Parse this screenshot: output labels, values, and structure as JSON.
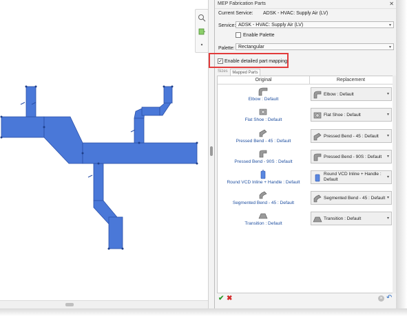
{
  "panel": {
    "title": "MEP Fabrication Parts",
    "close_glyph": "✕",
    "current_service_label": "Current Service:",
    "current_service_value": "ADSK - HVAC: Supply Air (LV)",
    "service_label": "Service:",
    "service_value": "ADSK - HVAC: Supply Air (LV)",
    "enable_palette_label": "Enable Palette",
    "palette_label": "Palette:",
    "palette_value": "Rectangular",
    "detailed_mapping_label": "Enable detailed part mapping",
    "detailed_mapping_checked": true,
    "tabs": [
      "Sizes",
      "Mapped Parts"
    ],
    "columns": [
      "Original",
      "Replacement"
    ],
    "rows": [
      {
        "original": "Elbow : Default",
        "replacement": "Elbow : Default",
        "icon": "elbow-icon"
      },
      {
        "original": "Flat Shoe : Default",
        "replacement": "Flat Shoe : Default",
        "icon": "flat-shoe-icon"
      },
      {
        "original": "Pressed Bend - 45 : Default",
        "replacement": "Pressed Bend - 45 : Default",
        "icon": "pressed-bend-45-icon"
      },
      {
        "original": "Pressed Bend - 90S : Default",
        "replacement": "Pressed Bend - 90S : Default",
        "icon": "pressed-bend-90s-icon"
      },
      {
        "original": "Round VCD Inline + Handle : Default",
        "replacement": "Round VCD Inline + Handle : Default",
        "icon": "damper-icon"
      },
      {
        "original": "Segmented Bend - 45 : Default",
        "replacement": "Segmented Bend - 45 : Default",
        "icon": "segmented-bend-icon"
      },
      {
        "original": "Transition : Default",
        "replacement": "Transition : Default",
        "icon": "transition-icon"
      }
    ]
  },
  "colors": {
    "duct_fill": "#4a78d8",
    "duct_stroke": "#2a4fa8",
    "highlight": "#e23b3b",
    "link_text": "#1f4fa0"
  }
}
